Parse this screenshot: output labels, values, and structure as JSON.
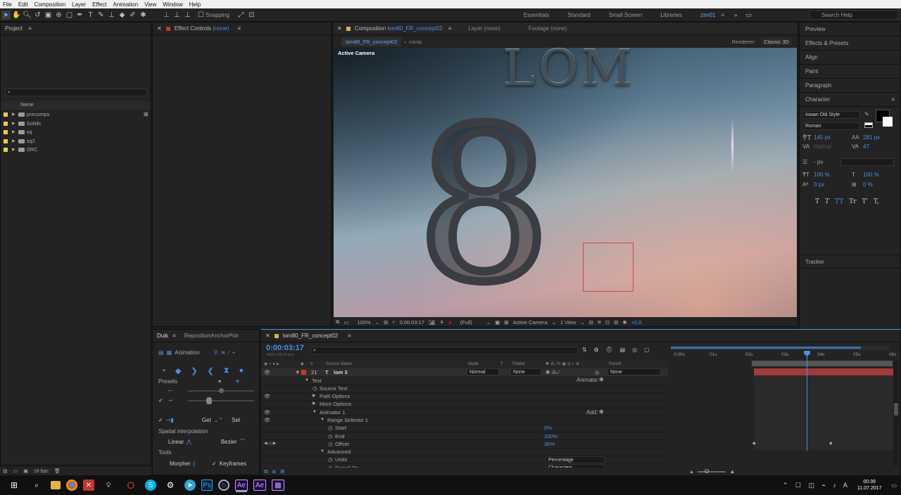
{
  "menu": [
    "File",
    "Edit",
    "Composition",
    "Layer",
    "Effect",
    "Animation",
    "View",
    "Window",
    "Help"
  ],
  "toolbar": {
    "snapping": "Snapping",
    "workspaces": [
      "Essentials",
      "Standard",
      "Small Screen",
      "Libraries",
      "zim01"
    ],
    "search_placeholder": "Search Help"
  },
  "project": {
    "title": "Project",
    "name_header": "Name",
    "items": [
      {
        "name": "precomps",
        "color": "#e8d23a"
      },
      {
        "name": "Solids",
        "color": "#e8d23a"
      },
      {
        "name": "sq",
        "color": "#e8d23a"
      },
      {
        "name": "sq2",
        "color": "#e8d23a"
      },
      {
        "name": "SRC",
        "color": "#e8d23a"
      }
    ],
    "bpc": "16 bpc"
  },
  "effect_controls": {
    "title": "Effect Controls",
    "none": "(none)"
  },
  "composition": {
    "tab_prefix": "Composition",
    "tab_name": "lom80_FR_concept02",
    "layer_tab": "Layer (none)",
    "footage_tab": "Footage (none)",
    "sub_active": "lom80_FR_concept02",
    "sub_comp": "comp",
    "renderer_label": "Renderer:",
    "renderer_value": "Classic 3D",
    "camera_label": "Active Camera",
    "viewer_text": "LOM",
    "figure_glyph": "8"
  },
  "viewer_bar": {
    "zoom": "100%",
    "time": "0:00:03:17",
    "quality": "(Full)",
    "camera": "Active Camera",
    "views": "1 View",
    "exposure": "+0,0"
  },
  "right_panel": {
    "items": [
      "Preview",
      "Effects & Presets",
      "Align",
      "Paint",
      "Paragraph"
    ],
    "character": "Character",
    "font": "Iowan Old Style",
    "style": "Roman",
    "size": "145 px",
    "leading": "281 px",
    "kerning": "Optical",
    "tracking": "47",
    "stroke": "- px",
    "vscale": "100 %",
    "hscale": "100 %",
    "baseline": "0 px",
    "tsume": "0 %",
    "tracker": "Tracker",
    "styles": [
      "T",
      "T",
      "TT",
      "Tr",
      "T'",
      "T,"
    ]
  },
  "duik": {
    "tab": "Duik",
    "tab2": "RepositionAnchorPoir",
    "animation": "Animation",
    "presets": "Presets",
    "get": "Get",
    "set": "Set",
    "spatial": "Spatial interpolation",
    "linear": "Linear",
    "bezier": "Bezier",
    "tools": "Tools",
    "morpher": "Morpher",
    "keyframes": "Keyframes"
  },
  "timeline": {
    "comp": "lom80_FR_concept02",
    "time": "0:00:03:17",
    "fps": "00092 (25.00 fps)",
    "col_source": "Source Name",
    "col_mode": "Mode",
    "col_t": "T",
    "col_trkmat": "TrkMat",
    "col_parent": "Parent",
    "layer_num": "21",
    "layer_name": "lom 3",
    "mode": "Normal",
    "trkmat": "None",
    "parent": "None",
    "animate": "Animate:",
    "add": "Add:",
    "props": [
      {
        "name": "Text",
        "indent": 0,
        "tw": "▼",
        "val": ""
      },
      {
        "name": "Source Text",
        "indent": 1,
        "tw": "",
        "val": ""
      },
      {
        "name": "Path Options",
        "indent": 1,
        "tw": "▶",
        "val": ""
      },
      {
        "name": "More Options",
        "indent": 1,
        "tw": "▶",
        "val": ""
      },
      {
        "name": "Animator 1",
        "indent": 1,
        "tw": "▼",
        "val": ""
      },
      {
        "name": "Range Selector 1",
        "indent": 2,
        "tw": "▼",
        "val": ""
      },
      {
        "name": "Start",
        "indent": 3,
        "tw": "",
        "val": "0%"
      },
      {
        "name": "End",
        "indent": 3,
        "tw": "",
        "val": "100%"
      },
      {
        "name": "Offset",
        "indent": 3,
        "tw": "",
        "val": "36%"
      },
      {
        "name": "Advanced",
        "indent": 2,
        "tw": "▼",
        "val": ""
      },
      {
        "name": "Units",
        "indent": 3,
        "tw": "",
        "val": "Percentage"
      },
      {
        "name": "Based On",
        "indent": 3,
        "tw": "",
        "val": "Characters"
      }
    ],
    "ruler": [
      "0:00s",
      "01s",
      "02s",
      "03s",
      "04s",
      "05s",
      "06s"
    ]
  },
  "taskbar": {
    "time": "00:39",
    "date": "11.07.2017"
  },
  "colors": {
    "accent": "#4a90e2",
    "layer_bar": "#a13b3b",
    "playhead": "#4a90e2"
  }
}
